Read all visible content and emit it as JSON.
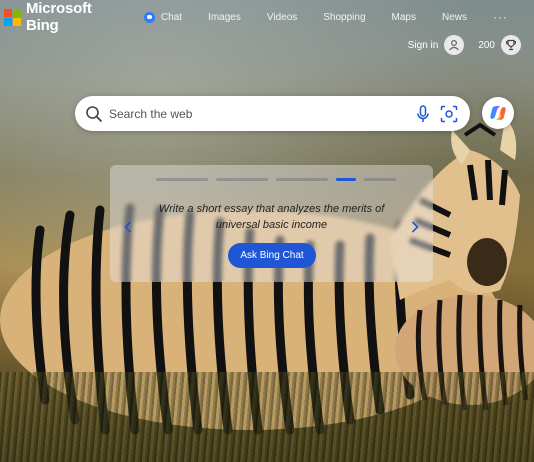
{
  "brand": {
    "name": "Microsoft Bing"
  },
  "nav": {
    "items": [
      {
        "label": "Chat",
        "icon": "bing-chat-icon"
      },
      {
        "label": "Images"
      },
      {
        "label": "Videos"
      },
      {
        "label": "Shopping"
      },
      {
        "label": "Maps"
      },
      {
        "label": "News"
      }
    ],
    "more": "···"
  },
  "account": {
    "signin": "Sign in",
    "points": "200"
  },
  "search": {
    "placeholder": "Search the web"
  },
  "carousel": {
    "prompt": "Write a short essay that analyzes the merits of universal basic income",
    "button": "Ask Bing Chat",
    "slide_count": 5,
    "active_slide": 4
  },
  "colors": {
    "accent": "#1f56d6",
    "chat_icon": "#2f7cf6"
  }
}
